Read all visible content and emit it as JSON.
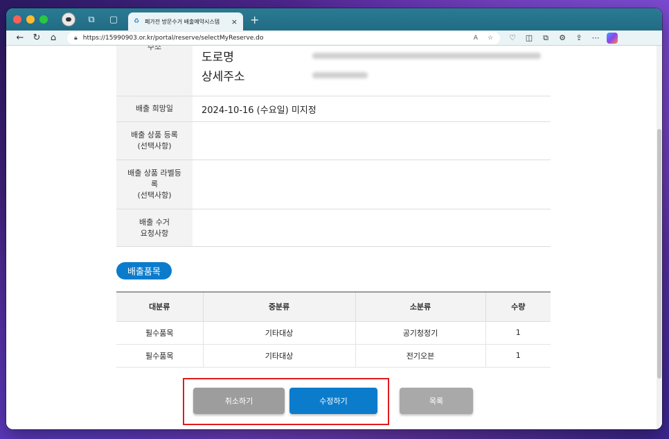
{
  "browser": {
    "tab_title": "폐가전 방문수거 배출예약시스템",
    "tab_close": "×",
    "new_tab": "+",
    "url": "https://15990903.or.kr/portal/reserve/selectMyReserve.do"
  },
  "reserve_info": {
    "address_header": "주소",
    "address_road_label": "도로명",
    "address_detail_label": "상세주소",
    "date_header": "배출 희망일",
    "date_value": "2024-10-16 (수요일) 미지정",
    "product_header": "배출 상품 등록\n(선택사항)",
    "label_header": "배출 상품 라벨등\n록\n(선택사항)",
    "request_header": "배출 수거\n요청사항"
  },
  "items_section": {
    "title": "배출품목",
    "columns": [
      "대분류",
      "중분류",
      "소분류",
      "수량"
    ],
    "rows": [
      [
        "필수품목",
        "기타대상",
        "공기청정기",
        "1"
      ],
      [
        "필수품목",
        "기타대상",
        "전기오븐",
        "1"
      ]
    ]
  },
  "buttons": {
    "cancel": "취소하기",
    "edit": "수정하기",
    "list": "목록"
  },
  "colors": {
    "accent": "#0b7ccc",
    "highlight": "#e01b1b"
  }
}
